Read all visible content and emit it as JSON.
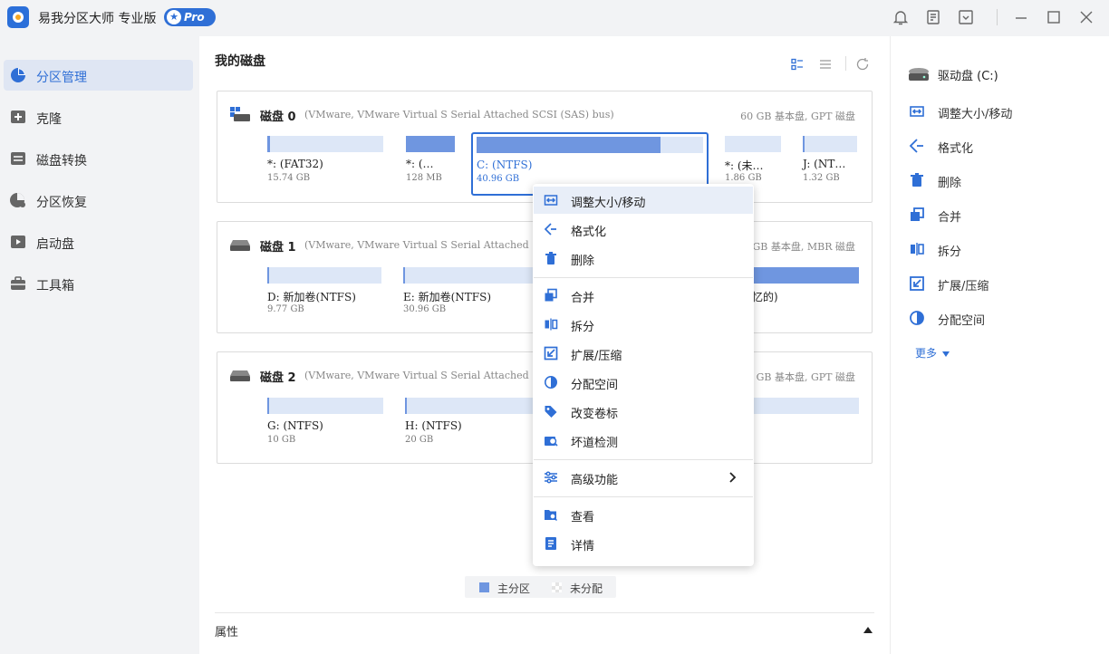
{
  "app": {
    "title": "易我分区大师 专业版",
    "badge": "Pro"
  },
  "sidebar": {
    "items": [
      {
        "label": "分区管理",
        "icon": "pie-icon",
        "active": true
      },
      {
        "label": "克隆",
        "icon": "clone-icon"
      },
      {
        "label": "磁盘转换",
        "icon": "convert-icon"
      },
      {
        "label": "分区恢复",
        "icon": "recover-icon"
      },
      {
        "label": "启动盘",
        "icon": "bootdisk-icon"
      },
      {
        "label": "工具箱",
        "icon": "toolbox-icon"
      }
    ]
  },
  "main": {
    "title": "我的磁盘",
    "disks": [
      {
        "name": "磁盘 0",
        "bus": "(VMware,  VMware Virtual S Serial Attached SCSI (SAS) bus)",
        "meta": "60 GB 基本盘, GPT 磁盘",
        "partitions": [
          {
            "name": "*: (FAT32)",
            "size": "15.74 GB",
            "used": 0.02,
            "type": "primary"
          },
          {
            "name": "*: (…",
            "size": "128 MB",
            "used": 1.0,
            "type": "primary"
          },
          {
            "name": "C: (NTFS)",
            "size": "40.96 GB",
            "used": 0.81,
            "type": "primary",
            "selected": true
          },
          {
            "name": "*: (未…",
            "size": "1.86 GB",
            "used": 0,
            "type": "unallocated"
          },
          {
            "name": "J: (NT…",
            "size": "1.32 GB",
            "used": 0.03,
            "type": "primary"
          }
        ]
      },
      {
        "name": "磁盘 1",
        "bus": "(VMware,  VMware Virtual S Serial Attached",
        "meta": "GB 基本盘, MBR 磁盘",
        "partitions": [
          {
            "name": "D: 新加卷(NTFS)",
            "size": "9.77 GB",
            "used": 0.01,
            "type": "primary"
          },
          {
            "name": "E: 新加卷(NTFS)",
            "size": "30.96 GB",
            "used": 0.01,
            "type": "primary"
          },
          {
            "name": "忆的)",
            "size": "",
            "used": 1.0,
            "type": "primary"
          }
        ]
      },
      {
        "name": "磁盘 2",
        "bus": "(VMware,  VMware Virtual S Serial Attached",
        "meta": "GB 基本盘, GPT 磁盘",
        "partitions": [
          {
            "name": "G: (NTFS)",
            "size": "10 GB",
            "used": 0.01,
            "type": "primary"
          },
          {
            "name": "H: (NTFS)",
            "size": "20 GB",
            "used": 0.01,
            "type": "primary"
          },
          {
            "name": "",
            "size": "",
            "used": 0,
            "type": "primary"
          }
        ]
      }
    ],
    "legend": {
      "primary": "主分区",
      "unallocated": "未分配"
    },
    "attributes_title": "属性"
  },
  "right_panel": {
    "header": "驱动盘  (C:)",
    "items": [
      {
        "label": "调整大小/移动",
        "icon": "resize-icon"
      },
      {
        "label": "格式化",
        "icon": "format-icon"
      },
      {
        "label": "删除",
        "icon": "trash-icon"
      },
      {
        "label": "合并",
        "icon": "merge-icon"
      },
      {
        "label": "拆分",
        "icon": "split-icon"
      },
      {
        "label": "扩展/压缩",
        "icon": "extend-icon"
      },
      {
        "label": "分配空间",
        "icon": "allocate-icon"
      }
    ],
    "more": "更多"
  },
  "context_menu": {
    "items": [
      {
        "label": "调整大小/移动",
        "icon": "resize-icon",
        "hover": true
      },
      {
        "label": "格式化",
        "icon": "format-icon"
      },
      {
        "label": "删除",
        "icon": "trash-icon"
      },
      {
        "label": "合并",
        "icon": "merge-icon"
      },
      {
        "label": "拆分",
        "icon": "split-icon"
      },
      {
        "label": "扩展/压缩",
        "icon": "extend-icon"
      },
      {
        "label": "分配空间",
        "icon": "allocate-icon"
      },
      {
        "label": "改变卷标",
        "icon": "tag-icon"
      },
      {
        "label": "坏道检测",
        "icon": "surface-test-icon"
      },
      {
        "label": "高级功能",
        "icon": "advanced-icon",
        "submenu": true
      },
      {
        "label": "查看",
        "icon": "explore-icon"
      },
      {
        "label": "详情",
        "icon": "details-icon"
      }
    ]
  },
  "colors": {
    "accent": "#2f6fd6",
    "partition_fill": "#6f96e0",
    "partition_bg": "#dde7f7",
    "sidebar_bg": "#f2f3f5",
    "sidebar_active": "#dfe6f3"
  }
}
